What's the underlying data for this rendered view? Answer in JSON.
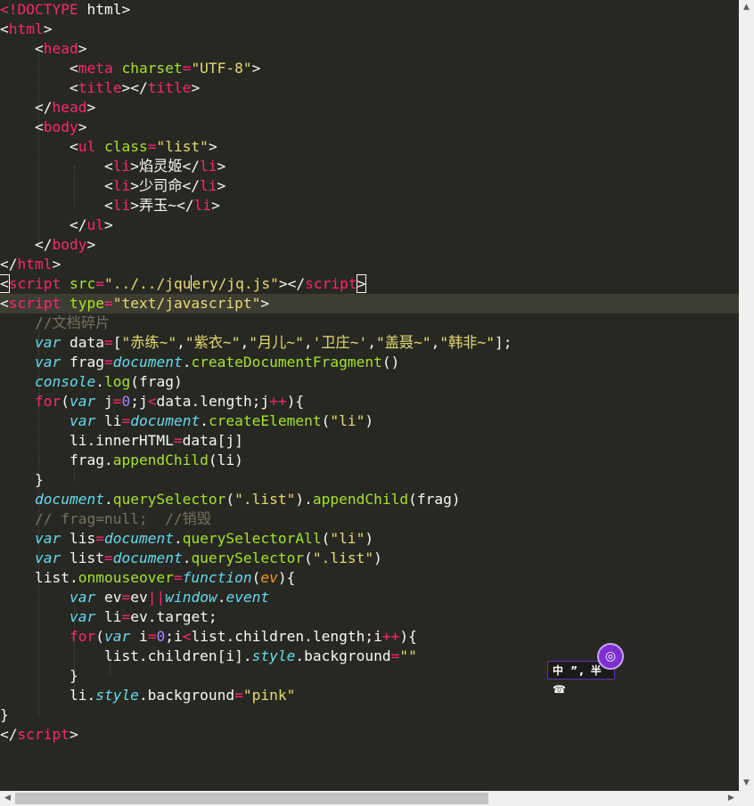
{
  "colors": {
    "background": "#272822",
    "current_line": "#3e3d32",
    "plain": "#f8f8f2",
    "tag": "#f92672",
    "attribute": "#a6e22e",
    "string": "#e6db74",
    "keyword": "#66d9ef",
    "number": "#ae81ff",
    "comment": "#75715e",
    "parameter": "#fd971f",
    "scrollbar": "#f0f0f0",
    "scroll_thumb": "#c2c2c2"
  },
  "editor": {
    "current_line": 15,
    "lines": [
      [
        [
          "t",
          "<!DOCTYPE"
        ],
        [
          "p",
          " html>"
        ]
      ],
      [
        [
          "p",
          "<"
        ],
        [
          "t",
          "html"
        ],
        [
          "p",
          ">"
        ]
      ],
      [
        [
          "p",
          "    <"
        ],
        [
          "t",
          "head"
        ],
        [
          "p",
          ">"
        ]
      ],
      [
        [
          "p",
          "        <"
        ],
        [
          "t",
          "meta"
        ],
        [
          "p",
          " "
        ],
        [
          "a",
          "charset"
        ],
        [
          "o",
          "="
        ],
        [
          "s",
          "\"UTF-8\""
        ],
        [
          "p",
          ">"
        ]
      ],
      [
        [
          "p",
          "        <"
        ],
        [
          "t",
          "title"
        ],
        [
          "p",
          "></"
        ],
        [
          "t",
          "title"
        ],
        [
          "p",
          ">"
        ]
      ],
      [
        [
          "p",
          "    </"
        ],
        [
          "t",
          "head"
        ],
        [
          "p",
          ">"
        ]
      ],
      [
        [
          "p",
          "    <"
        ],
        [
          "t",
          "body"
        ],
        [
          "p",
          ">"
        ]
      ],
      [
        [
          "p",
          "        <"
        ],
        [
          "t",
          "ul"
        ],
        [
          "p",
          " "
        ],
        [
          "a",
          "class"
        ],
        [
          "o",
          "="
        ],
        [
          "s",
          "\"list\""
        ],
        [
          "p",
          ">"
        ]
      ],
      [
        [
          "p",
          "            <"
        ],
        [
          "t",
          "li"
        ],
        [
          "p",
          ">焰灵姬</"
        ],
        [
          "t",
          "li"
        ],
        [
          "p",
          ">"
        ]
      ],
      [
        [
          "p",
          "            <"
        ],
        [
          "t",
          "li"
        ],
        [
          "p",
          ">少司命</"
        ],
        [
          "t",
          "li"
        ],
        [
          "p",
          ">"
        ]
      ],
      [
        [
          "p",
          "            <"
        ],
        [
          "t",
          "li"
        ],
        [
          "p",
          ">弄玉~</"
        ],
        [
          "t",
          "li"
        ],
        [
          "p",
          ">"
        ]
      ],
      [
        [
          "p",
          "        </"
        ],
        [
          "t",
          "ul"
        ],
        [
          "p",
          ">"
        ]
      ],
      [
        [
          "p",
          "    </"
        ],
        [
          "t",
          "body"
        ],
        [
          "p",
          ">"
        ]
      ],
      [
        [
          "p",
          "</"
        ],
        [
          "t",
          "html"
        ],
        [
          "p",
          ">"
        ]
      ],
      [
        [
          "x",
          "<"
        ],
        [
          "t",
          "script"
        ],
        [
          "p",
          " "
        ],
        [
          "a",
          "src"
        ],
        [
          "o",
          "="
        ],
        [
          "s",
          "\"../../jqu"
        ],
        [
          "cur",
          ""
        ],
        [
          "s",
          "ery/jq.js\""
        ],
        [
          "p",
          "></"
        ],
        [
          "t",
          "script"
        ],
        [
          "x",
          ">"
        ]
      ],
      [
        [
          "p",
          "<"
        ],
        [
          "t",
          "script"
        ],
        [
          "p",
          " "
        ],
        [
          "a",
          "type"
        ],
        [
          "o",
          "="
        ],
        [
          "s",
          "\"text/javascript\""
        ],
        [
          "p",
          ">"
        ]
      ],
      [
        [
          "p",
          "    "
        ],
        [
          "c",
          "//文档碎片"
        ]
      ],
      [
        [
          "p",
          "    "
        ],
        [
          "k",
          "var"
        ],
        [
          "p",
          " data"
        ],
        [
          "o",
          "="
        ],
        [
          "p",
          "["
        ],
        [
          "s",
          "\"赤练~\""
        ],
        [
          "p",
          ","
        ],
        [
          "s",
          "\"紫衣~\""
        ],
        [
          "p",
          ","
        ],
        [
          "s",
          "\"月儿~\""
        ],
        [
          "p",
          ","
        ],
        [
          "s",
          "'卫庄~'"
        ],
        [
          "p",
          ","
        ],
        [
          "s",
          "\"盖聂~\""
        ],
        [
          "p",
          ","
        ],
        [
          "s",
          "\"韩非~\""
        ],
        [
          "p",
          "];"
        ]
      ],
      [
        [
          "p",
          "    "
        ],
        [
          "k",
          "var"
        ],
        [
          "p",
          " frag"
        ],
        [
          "o",
          "="
        ],
        [
          "b",
          "document"
        ],
        [
          "p",
          "."
        ],
        [
          "f",
          "createDocumentFragment"
        ],
        [
          "p",
          "()"
        ]
      ],
      [
        [
          "p",
          "    "
        ],
        [
          "b",
          "console"
        ],
        [
          "p",
          "."
        ],
        [
          "f",
          "log"
        ],
        [
          "p",
          "(frag)"
        ]
      ],
      [
        [
          "p",
          "    "
        ],
        [
          "t",
          "for"
        ],
        [
          "p",
          "("
        ],
        [
          "k",
          "var"
        ],
        [
          "p",
          " j"
        ],
        [
          "o",
          "="
        ],
        [
          "n",
          "0"
        ],
        [
          "p",
          ";j"
        ],
        [
          "o",
          "<"
        ],
        [
          "p",
          "data.length;j"
        ],
        [
          "o",
          "++"
        ],
        [
          "p",
          "){"
        ]
      ],
      [
        [
          "p",
          "        "
        ],
        [
          "k",
          "var"
        ],
        [
          "p",
          " li"
        ],
        [
          "o",
          "="
        ],
        [
          "b",
          "document"
        ],
        [
          "p",
          "."
        ],
        [
          "f",
          "createElement"
        ],
        [
          "p",
          "("
        ],
        [
          "s",
          "\"li\""
        ],
        [
          "p",
          ")"
        ]
      ],
      [
        [
          "p",
          "        li.innerHTML"
        ],
        [
          "o",
          "="
        ],
        [
          "p",
          "data[j]"
        ]
      ],
      [
        [
          "p",
          "        frag."
        ],
        [
          "f",
          "appendChild"
        ],
        [
          "p",
          "(li)"
        ]
      ],
      [
        [
          "p",
          "    }"
        ]
      ],
      [
        [
          "p",
          "    "
        ],
        [
          "b",
          "document"
        ],
        [
          "p",
          "."
        ],
        [
          "f",
          "querySelector"
        ],
        [
          "p",
          "("
        ],
        [
          "s",
          "\".list\""
        ],
        [
          "p",
          ")."
        ],
        [
          "f",
          "appendChild"
        ],
        [
          "p",
          "(frag)"
        ]
      ],
      [
        [
          "p",
          "    "
        ],
        [
          "c",
          "// frag=null;  //销毁"
        ]
      ],
      [
        [
          "p",
          "    "
        ],
        [
          "k",
          "var"
        ],
        [
          "p",
          " lis"
        ],
        [
          "o",
          "="
        ],
        [
          "b",
          "document"
        ],
        [
          "p",
          "."
        ],
        [
          "f",
          "querySelectorAll"
        ],
        [
          "p",
          "("
        ],
        [
          "s",
          "\"li\""
        ],
        [
          "p",
          ")"
        ]
      ],
      [
        [
          "p",
          "    "
        ],
        [
          "k",
          "var"
        ],
        [
          "p",
          " list"
        ],
        [
          "o",
          "="
        ],
        [
          "b",
          "document"
        ],
        [
          "p",
          "."
        ],
        [
          "f",
          "querySelector"
        ],
        [
          "p",
          "("
        ],
        [
          "s",
          "\".list\""
        ],
        [
          "p",
          ")"
        ]
      ],
      [
        [
          "p",
          "    list."
        ],
        [
          "f",
          "onmouseover"
        ],
        [
          "o",
          "="
        ],
        [
          "k",
          "function"
        ],
        [
          "p",
          "("
        ],
        [
          "v",
          "ev"
        ],
        [
          "p",
          "){"
        ]
      ],
      [
        [
          "p",
          "        "
        ],
        [
          "k",
          "var"
        ],
        [
          "p",
          " ev"
        ],
        [
          "o",
          "="
        ],
        [
          "p",
          "ev"
        ],
        [
          "o",
          "||"
        ],
        [
          "b",
          "window"
        ],
        [
          "p",
          "."
        ],
        [
          "b",
          "event"
        ]
      ],
      [
        [
          "p",
          "        "
        ],
        [
          "k",
          "var"
        ],
        [
          "p",
          " li"
        ],
        [
          "o",
          "="
        ],
        [
          "p",
          "ev.target;"
        ]
      ],
      [
        [
          "p",
          "        "
        ],
        [
          "t",
          "for"
        ],
        [
          "p",
          "("
        ],
        [
          "k",
          "var"
        ],
        [
          "p",
          " i"
        ],
        [
          "o",
          "="
        ],
        [
          "n",
          "0"
        ],
        [
          "p",
          ";i"
        ],
        [
          "o",
          "<"
        ],
        [
          "p",
          "list.children.length;i"
        ],
        [
          "o",
          "++"
        ],
        [
          "p",
          "){"
        ]
      ],
      [
        [
          "p",
          "            list.children[i]."
        ],
        [
          "b",
          "style"
        ],
        [
          "p",
          ".background"
        ],
        [
          "o",
          "="
        ],
        [
          "s",
          "\"\""
        ]
      ],
      [
        [
          "p",
          "        }"
        ]
      ],
      [
        [
          "p",
          "        li."
        ],
        [
          "b",
          "style"
        ],
        [
          "p",
          ".background"
        ],
        [
          "o",
          "="
        ],
        [
          "s",
          "\"pink\""
        ]
      ],
      [
        [
          "p",
          "}"
        ]
      ],
      [
        [
          "p",
          "</"
        ],
        [
          "t",
          "script"
        ],
        [
          "p",
          ">"
        ]
      ]
    ]
  },
  "ime": {
    "label": "中 ”, 半 ☎",
    "logo": "◎"
  },
  "scrollbars": {
    "up": "▲",
    "down": "▼",
    "left": "◀",
    "right": "▶"
  }
}
